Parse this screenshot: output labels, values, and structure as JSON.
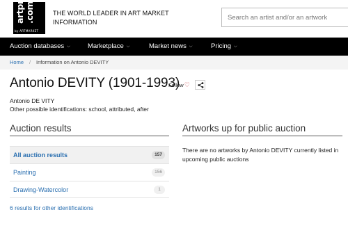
{
  "header": {
    "logo_line1": "artprice",
    "logo_line2": ".com",
    "logo_subtitle": "by ARTMARKET",
    "tagline": "THE WORLD LEADER IN ART MARKET INFORMATION",
    "search_placeholder": "Search an artist and/or an artwork"
  },
  "nav": {
    "items": [
      {
        "label": "Auction databases"
      },
      {
        "label": "Marketplace"
      },
      {
        "label": "Market news"
      },
      {
        "label": "Pricing"
      }
    ]
  },
  "breadcrumb": {
    "home": "Home",
    "separator": "/",
    "current": "Information on Antonio DEVITY"
  },
  "artist": {
    "name": "Antonio DEVITY (1901-1993)",
    "follow_label": "Follow",
    "alt_name": "Antonio DE VITY",
    "other_identifications": "Other possible identifications: school, attributed, after"
  },
  "auction_results": {
    "title": "Auction results",
    "rows": [
      {
        "label": "All auction results",
        "count": "157",
        "active": true
      },
      {
        "label": "Painting",
        "count": "156",
        "active": false
      },
      {
        "label": "Drawing-Watercolor",
        "count": "1",
        "active": false
      }
    ],
    "other_link": "6 results for other identifications"
  },
  "public_auction": {
    "title": "Artworks up for public auction",
    "message": "There are no artworks by Antonio DEVITY currently listed in upcoming public auctions"
  },
  "colors": {
    "link": "#2a6fb0",
    "nav_bg": "#000000",
    "heart": "#c0262d"
  }
}
